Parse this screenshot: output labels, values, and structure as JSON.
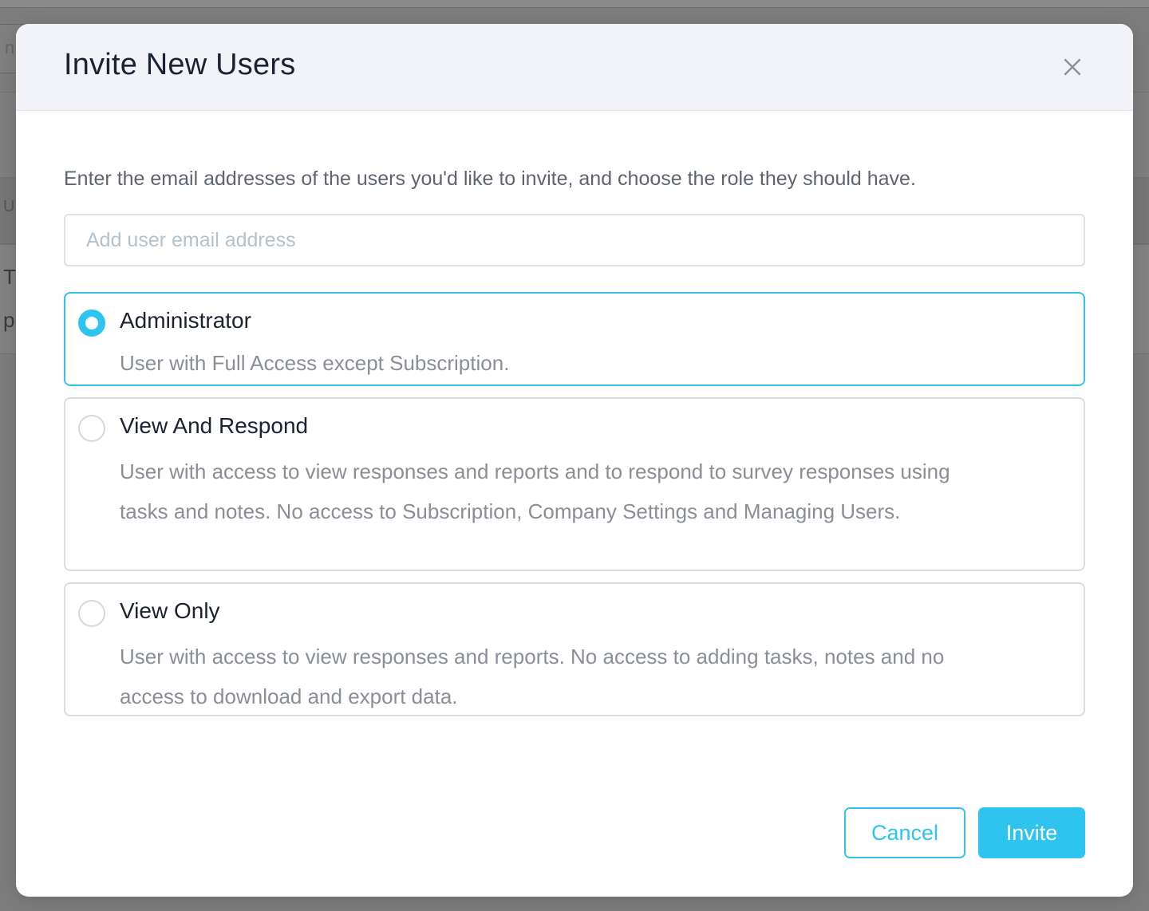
{
  "background": {
    "search_fragment": "n",
    "letters": [
      "U",
      "T",
      "p"
    ]
  },
  "modal": {
    "title": "Invite New Users",
    "close_icon": "close-icon",
    "intro": "Enter the email addresses of the users you'd like to invite, and choose the role they should have.",
    "email_input": {
      "value": "",
      "placeholder": "Add user email address"
    },
    "roles": [
      {
        "label": "Administrator",
        "description": "User with Full Access except Subscription.",
        "selected": true
      },
      {
        "label": "View And Respond",
        "description": "User with access to view responses and reports and to respond to survey responses using tasks and notes. No access to Subscription, Company Settings and Managing Users.",
        "selected": false
      },
      {
        "label": "View Only",
        "description": "User with access to view responses and reports. No access to adding tasks, notes and no access to download and export data.",
        "selected": false
      }
    ],
    "buttons": {
      "cancel_label": "Cancel",
      "invite_label": "Invite"
    }
  },
  "colors": {
    "accent": "#2ec4ef",
    "header_bg": "#f1f3f8",
    "overlay": "#7f7f7f"
  }
}
